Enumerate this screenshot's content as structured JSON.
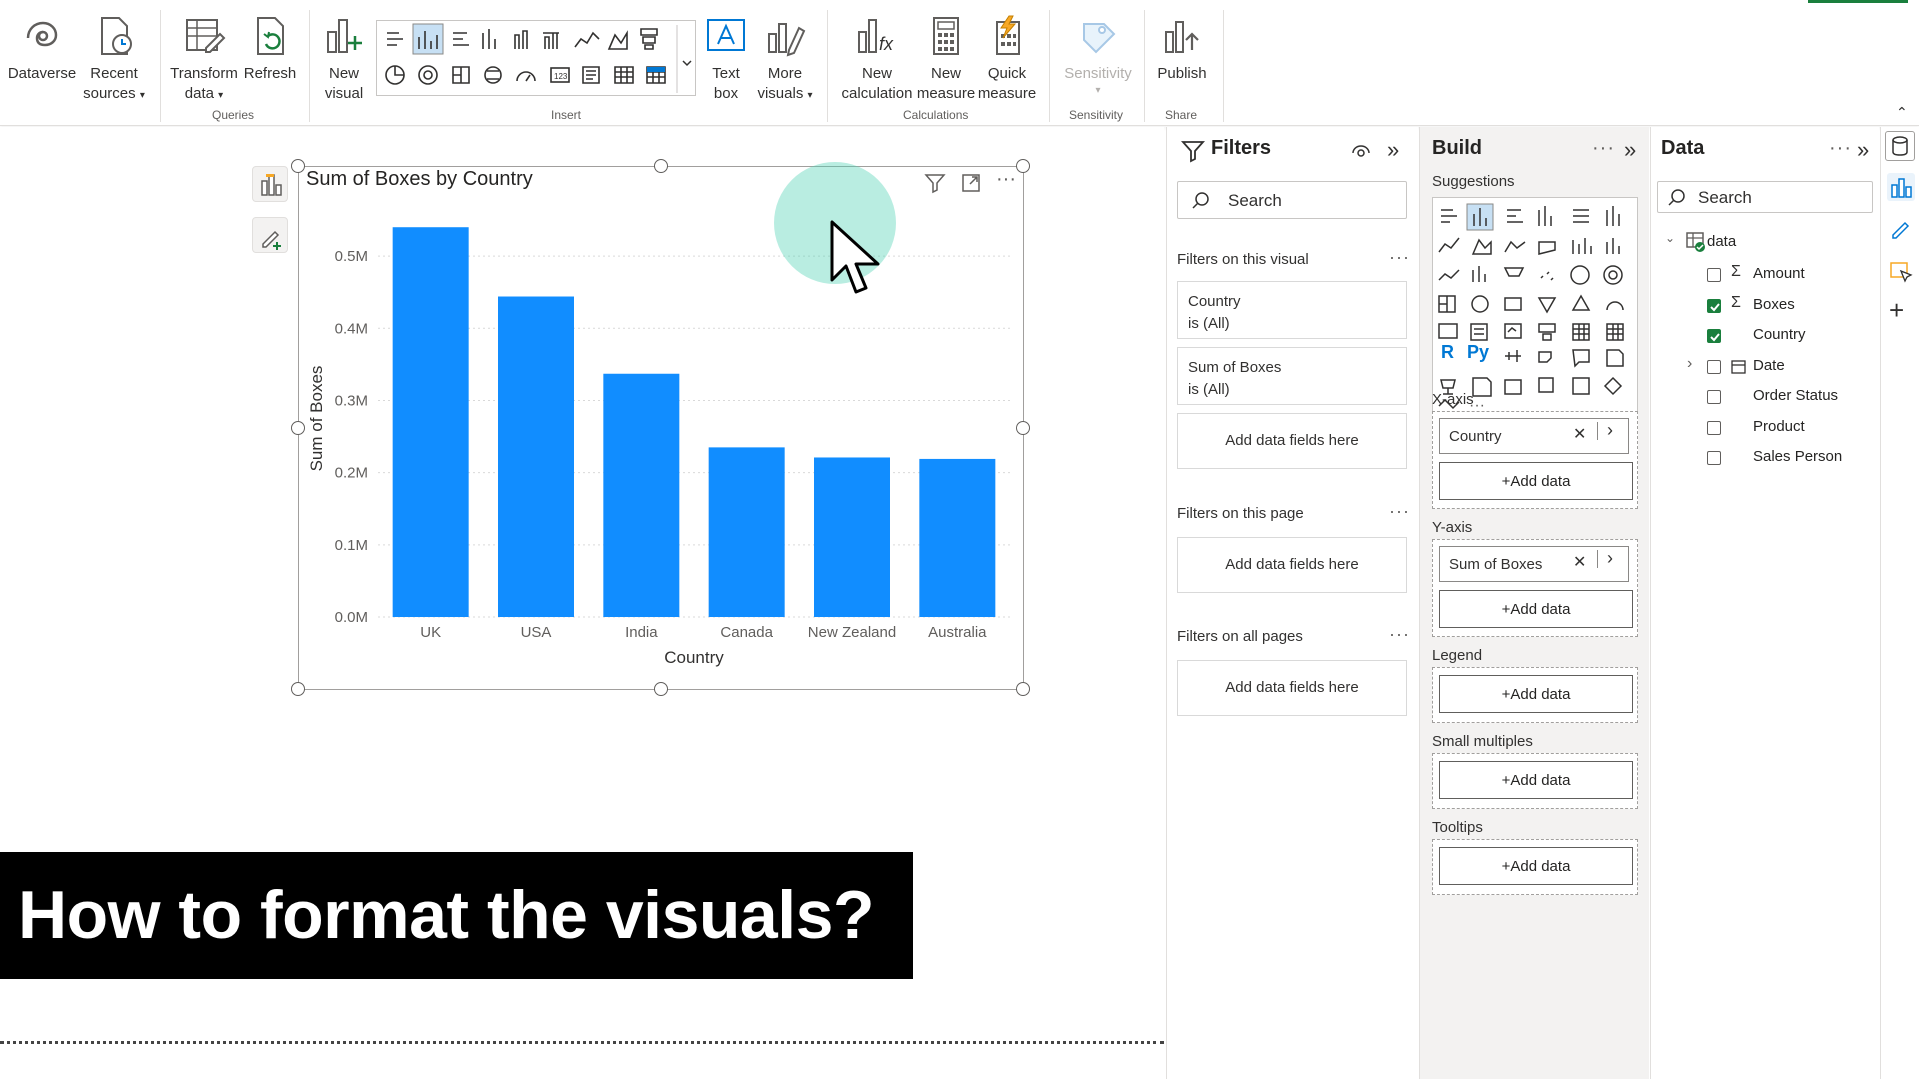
{
  "ribbon": {
    "buttons": [
      {
        "id": "dataverse",
        "label": [
          "Dataverse"
        ]
      },
      {
        "id": "recent",
        "label": [
          "Recent",
          "sources"
        ]
      },
      {
        "id": "transform",
        "label": [
          "Transform",
          "data"
        ]
      },
      {
        "id": "refresh",
        "label": [
          "Refresh"
        ]
      },
      {
        "id": "newvisual",
        "label": [
          "New",
          "visual"
        ]
      },
      {
        "id": "textbox",
        "label": [
          "Text",
          "box"
        ]
      },
      {
        "id": "morevisuals",
        "label": [
          "More",
          "visuals"
        ]
      },
      {
        "id": "newcalc",
        "label": [
          "New",
          "calculation"
        ]
      },
      {
        "id": "newmeasure",
        "label": [
          "New",
          "measure"
        ]
      },
      {
        "id": "quickmeasure",
        "label": [
          "Quick",
          "measure"
        ]
      },
      {
        "id": "sensitivity",
        "label": [
          "Sensitivity"
        ]
      },
      {
        "id": "publish",
        "label": [
          "Publish"
        ]
      }
    ],
    "groups": {
      "queries": "Queries",
      "insert": "Insert",
      "calculations": "Calculations",
      "sensitivity": "Sensitivity",
      "share": "Share"
    }
  },
  "visual": {
    "title": "Sum of Boxes by Country"
  },
  "chart_data": {
    "type": "bar",
    "title": "Sum of Boxes by Country",
    "categories": [
      "UK",
      "USA",
      "India",
      "Canada",
      "New Zealand",
      "Australia"
    ],
    "values": [
      0.54,
      0.444,
      0.337,
      0.235,
      0.221,
      0.219
    ],
    "value_unit": "M",
    "xlabel": "Country",
    "ylabel": "Sum of Boxes",
    "yticks": [
      "0.0M",
      "0.1M",
      "0.2M",
      "0.3M",
      "0.4M",
      "0.5M"
    ],
    "ylim": [
      0,
      0.55
    ],
    "grid": true,
    "bar_color": "#118DFF"
  },
  "overlay": {
    "caption": "How to format the visuals?"
  },
  "filters": {
    "title": "Filters",
    "search_placeholder": "Search",
    "on_visual": "Filters on this visual",
    "cards": [
      {
        "field": "Country",
        "state": "is (All)"
      },
      {
        "field": "Sum of Boxes",
        "state": "is (All)"
      }
    ],
    "add_fields": "Add data fields here",
    "on_page": "Filters on this page",
    "on_all": "Filters on all pages"
  },
  "build": {
    "title": "Build",
    "suggestions": "Suggestions",
    "xaxis": {
      "label": "X-axis",
      "field": "Country"
    },
    "yaxis": {
      "label": "Y-axis",
      "field": "Sum of Boxes"
    },
    "legend": "Legend",
    "small_multiples": "Small multiples",
    "tooltips": "Tooltips",
    "add_data": "+Add data"
  },
  "data": {
    "title": "Data",
    "search_placeholder": "Search",
    "table": "data",
    "fields": [
      {
        "name": "Amount",
        "checked": false,
        "sigma": true
      },
      {
        "name": "Boxes",
        "checked": true,
        "sigma": true
      },
      {
        "name": "Country",
        "checked": true,
        "sigma": false
      },
      {
        "name": "Date",
        "checked": false,
        "sigma": false
      },
      {
        "name": "Order Status",
        "checked": false,
        "sigma": false
      },
      {
        "name": "Product",
        "checked": false,
        "sigma": false
      },
      {
        "name": "Sales Person",
        "checked": false,
        "sigma": false
      }
    ]
  },
  "colors": {
    "accent": "#118DFF",
    "highlight": "#4FD1B4"
  }
}
